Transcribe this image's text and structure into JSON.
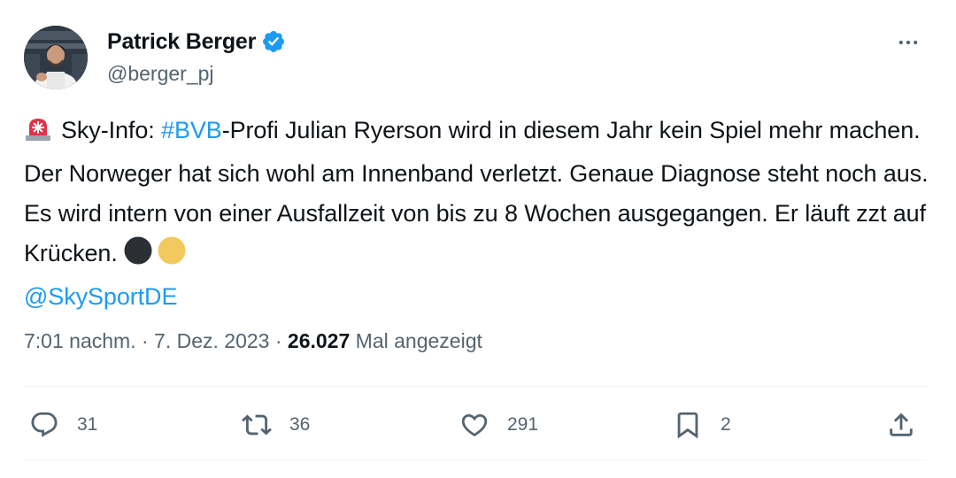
{
  "author": {
    "name": "Patrick Berger",
    "handle": "@berger_pj",
    "verified": true
  },
  "tweet": {
    "siren_emoji": "siren-icon",
    "text_part1": "Sky-Info: ",
    "hashtag": "#BVB",
    "text_part2": "-Profi Julian Ryerson wird in diesem Jahr kein Spiel mehr machen. Der Norweger hat sich wohl am Innenband verletzt. Genaue Diagnose steht noch aus. Es wird intern von einer Ausfallzeit von bis zu 8 Wochen ausgegangen. Er läuft zzt auf Krücken. ",
    "mention": "@SkySportDE",
    "emoji_circles": [
      "#292f33",
      "#f2c95e"
    ]
  },
  "meta": {
    "time": "7:01 nachm.",
    "separator1": " · ",
    "date": "7. Dez. 2023",
    "separator2": " · ",
    "views_count": "26.027",
    "views_label": " Mal angezeigt"
  },
  "actions": {
    "replies": "31",
    "retweets": "36",
    "likes": "291",
    "bookmarks": "2"
  },
  "colors": {
    "accent": "#1d9bf0",
    "text": "#0f1419",
    "muted": "#536471",
    "siren": "#e0334a"
  },
  "icons": {
    "more": "more-horizontal-icon",
    "reply": "reply-icon",
    "retweet": "retweet-icon",
    "like": "heart-icon",
    "bookmark": "bookmark-icon",
    "share": "share-icon",
    "verified": "verified-badge-icon"
  }
}
